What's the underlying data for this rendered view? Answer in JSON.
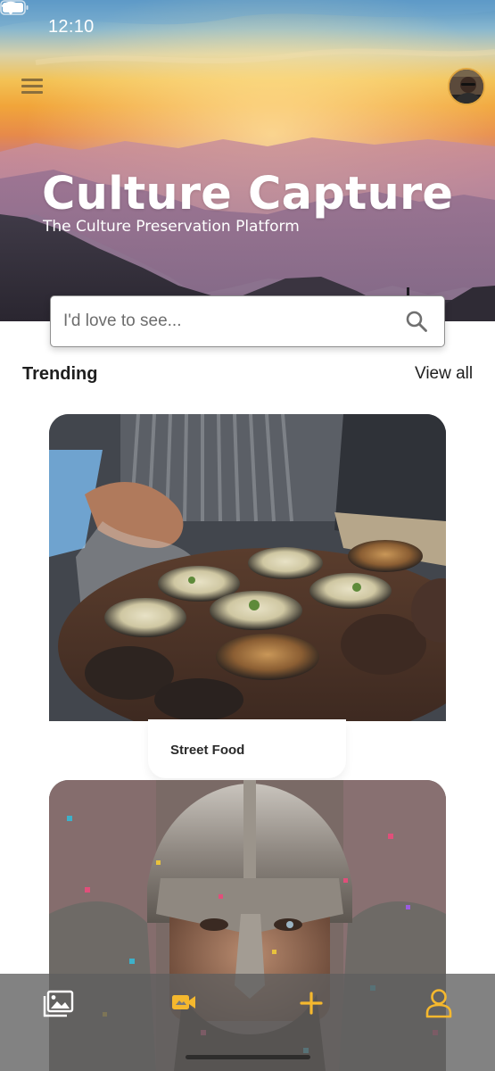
{
  "status_bar": {
    "time": "12:10"
  },
  "header": {
    "title": "Culture Capture",
    "subtitle": "The Culture Preservation Platform",
    "menu_icon": "hamburger-menu-icon",
    "avatar_icon": "user-avatar"
  },
  "search": {
    "placeholder": "I'd love to see...",
    "value": ""
  },
  "trending": {
    "heading": "Trending",
    "view_all_label": "View all",
    "cards": [
      {
        "label": "Street Food",
        "image": "clay-pots-street-food-photo"
      },
      {
        "label": "",
        "image": "helmeted-warrior-confetti-photo"
      }
    ]
  },
  "bottom_nav": {
    "items": [
      {
        "name": "gallery",
        "icon": "image-gallery-icon"
      },
      {
        "name": "video",
        "icon": "video-camera-icon"
      },
      {
        "name": "add",
        "icon": "plus-icon"
      },
      {
        "name": "profile",
        "icon": "user-profile-icon"
      }
    ]
  },
  "colors": {
    "accent": "#f5b82e",
    "nav_background": "#5f5f5f",
    "text_dark": "#1e1e1e"
  }
}
